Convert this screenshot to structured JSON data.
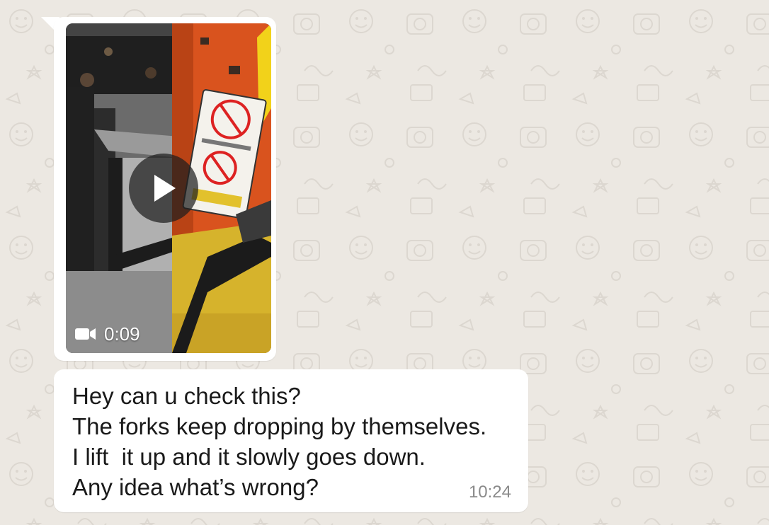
{
  "chat": {
    "video_message": {
      "duration": "0:09",
      "play_icon": "play-icon",
      "camera_icon": "video-camera-icon"
    },
    "text_message": {
      "lines": [
        "Hey can u check this?",
        "The forks keep dropping by themselves.",
        "I lift  it up and it slowly goes down.",
        "Any idea what’s wrong?"
      ],
      "time": "10:24"
    }
  },
  "colors": {
    "wallpaper": "#ece8e2",
    "bubble": "#ffffff",
    "timestamp": "#8a8a8a"
  }
}
